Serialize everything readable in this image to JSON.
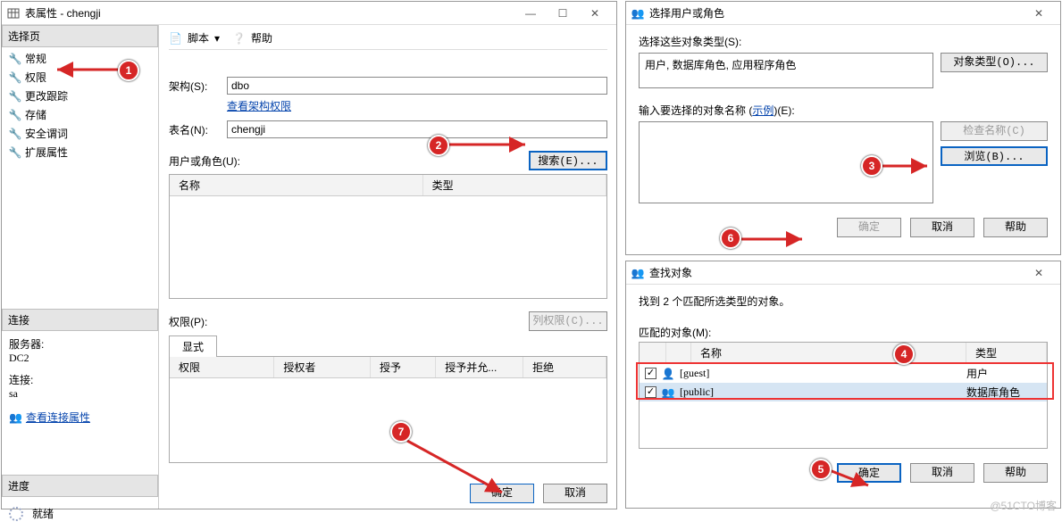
{
  "propsWin": {
    "title": "表属性 - chengji",
    "left": {
      "selectPage": "选择页",
      "items": [
        "常规",
        "权限",
        "更改跟踪",
        "存储",
        "安全谓词",
        "扩展属性"
      ],
      "connection": "连接",
      "serverLbl": "服务器:",
      "serverVal": "DC2",
      "connLbl": "连接:",
      "connVal": "sa",
      "viewConnProps": "查看连接属性",
      "progress": "进度",
      "ready": "就绪"
    },
    "toolbar": {
      "script": "脚本",
      "help": "帮助"
    },
    "form": {
      "schemaLbl": "架构(S):",
      "schemaVal": "dbo",
      "viewSchemaPerm": "查看架构权限",
      "tableLbl": "表名(N):",
      "tableVal": "chengji",
      "userRoleLbl": "用户或角色(U):",
      "searchBtn": "搜索(E)...",
      "gridHdr": {
        "name": "名称",
        "type": "类型"
      },
      "permLbl": "权限(P):",
      "colPermBtn": "列权限(C)...",
      "tabExplicit": "显式",
      "permGridHdr": [
        "权限",
        "授权者",
        "授予",
        "授予并允...",
        "拒绝"
      ]
    },
    "footer": {
      "ok": "确定",
      "cancel": "取消"
    }
  },
  "selectUserWin": {
    "title": "选择用户或角色",
    "typesLbl": "选择这些对象类型(S):",
    "typesVal": "用户, 数据库角色, 应用程序角色",
    "objTypesBtn": "对象类型(O)...",
    "namesLbl": "输入要选择的对象名称 (示例)(E):",
    "examplesLink": "示例",
    "checkBtn": "检查名称(C)",
    "browseBtn": "浏览(B)...",
    "ok": "确定",
    "cancel": "取消",
    "help": "帮助"
  },
  "browseWin": {
    "title": "查找对象",
    "foundMsg": "找到 2 个匹配所选类型的对象。",
    "matchLbl": "匹配的对象(M):",
    "hdr": {
      "name": "名称",
      "type": "类型"
    },
    "rows": [
      {
        "name": "[guest]",
        "type": "用户",
        "checked": true
      },
      {
        "name": "[public]",
        "type": "数据库角色",
        "checked": true
      }
    ],
    "ok": "确定",
    "cancel": "取消",
    "help": "帮助"
  },
  "watermark": "@51CTO博客"
}
